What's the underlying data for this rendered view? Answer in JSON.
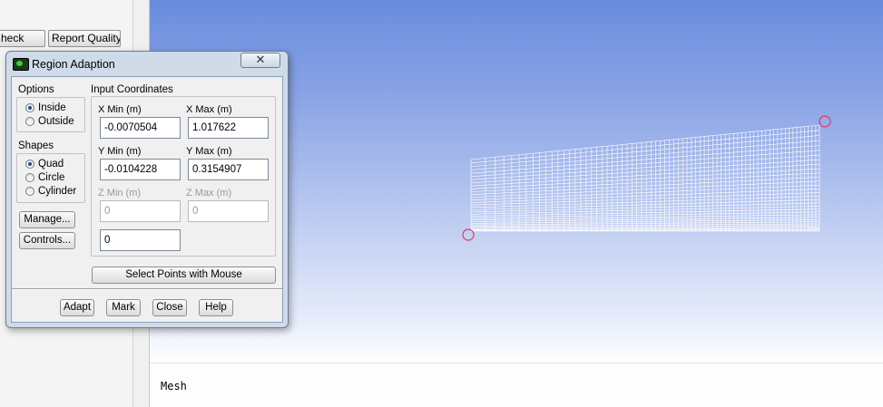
{
  "background_panel": {
    "check_button": "heck",
    "report_quality_button": "Report Quality"
  },
  "graphics": {
    "status_label": "Mesh",
    "background_color_top": "#6a8bde",
    "background_color_bottom": "#ffffff",
    "mesh_color": "#ffffff",
    "marker_color": "#e0386c"
  },
  "dialog": {
    "title": "Region Adaption",
    "close_glyph": "✕",
    "options": {
      "label": "Options",
      "items": [
        {
          "label": "Inside",
          "selected": true
        },
        {
          "label": "Outside",
          "selected": false
        }
      ]
    },
    "shapes": {
      "label": "Shapes",
      "items": [
        {
          "label": "Quad",
          "selected": true
        },
        {
          "label": "Circle",
          "selected": false
        },
        {
          "label": "Cylinder",
          "selected": false
        }
      ]
    },
    "manage_button": "Manage...",
    "controls_button": "Controls...",
    "input_coordinates": {
      "label": "Input Coordinates",
      "x_min_label": "X Min (m)",
      "x_min_value": "-0.0070504",
      "x_max_label": "X Max (m)",
      "x_max_value": "1.017622",
      "y_min_label": "Y Min (m)",
      "y_min_value": "-0.0104228",
      "y_max_label": "Y Max (m)",
      "y_max_value": "0.3154907",
      "z_min_label": "Z Min (m)",
      "z_min_value": "0",
      "z_max_label": "Z Max (m)",
      "z_max_value": "0",
      "radius_value": "0"
    },
    "select_points_button": "Select Points with Mouse",
    "footer": {
      "adapt": "Adapt",
      "mark": "Mark",
      "close": "Close",
      "help": "Help"
    }
  }
}
